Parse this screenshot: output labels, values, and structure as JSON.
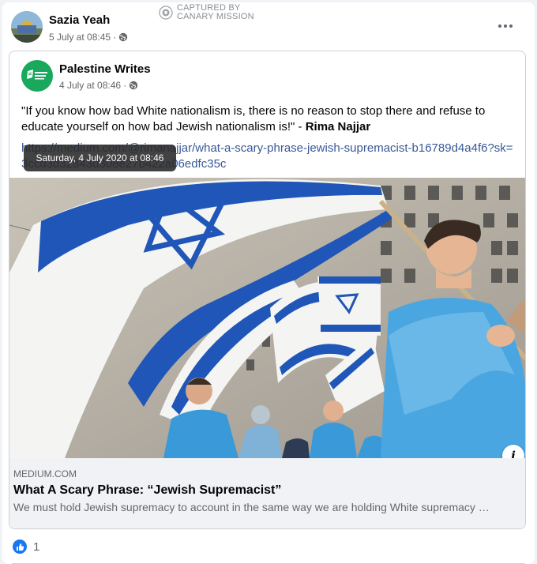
{
  "post": {
    "author": "Sazia Yeah",
    "timestamp": "5 July at 08:45",
    "privacy_icon": "globe-icon"
  },
  "watermark": {
    "line1": "CAPTURED BY",
    "line2": "CANARY MISSION"
  },
  "shared_post": {
    "page_name": "Palestine Writes",
    "timestamp": "4 July at 08:46",
    "privacy_icon": "globe-icon",
    "quote_hidden_start": "\"If you know how bad",
    "quote_visible": " White nationalism is, there is no reason to stop there and refuse to educate yourself on how bad Jewish nationalism is!\" - ",
    "quote_author": "Rima Najjar",
    "link": "https://medium.com/@rimanajjar/what-a-scary-phrase-jewish-supremacist-b16789d4a4f6?sk=3ccd3d32843d308e27b422a06edfc35c"
  },
  "tooltip": {
    "text": "Saturday, 4 July 2020 at 08:46"
  },
  "link_preview": {
    "domain": "MEDIUM.COM",
    "title": "What A Scary Phrase: “Jewish Supremacist”",
    "description": "We must hold Jewish supremacy to account in the same way we are holding White supremacy …",
    "info_icon": "info-icon"
  },
  "reactions": {
    "icon": "like-icon",
    "count": "1"
  },
  "colors": {
    "link": "#385898",
    "like": "#1877f2",
    "flag_blue": "#1f56b8"
  }
}
